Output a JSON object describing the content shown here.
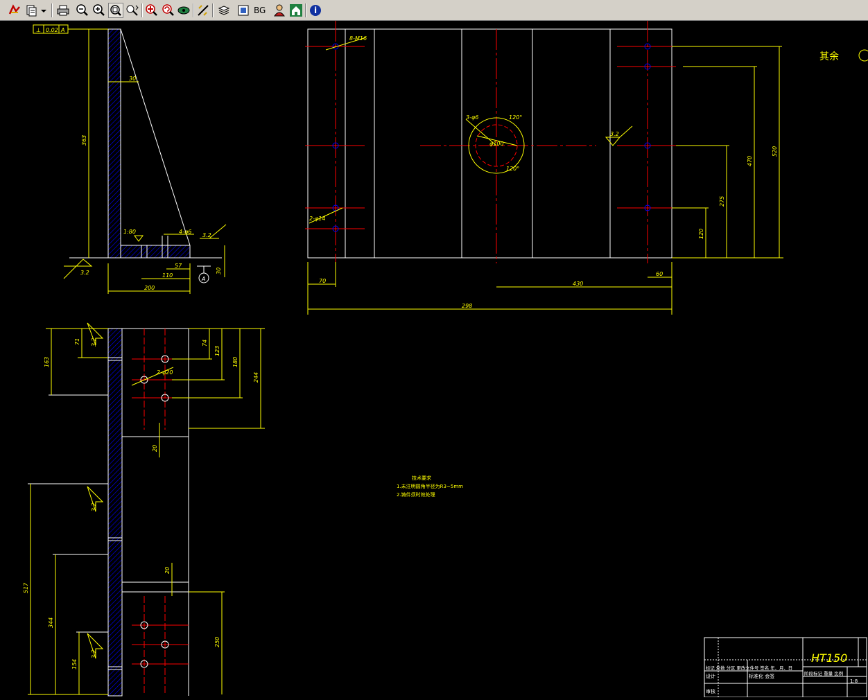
{
  "toolbar": {
    "buttons": [
      {
        "name": "open-icon"
      },
      {
        "name": "pages-icon"
      },
      {
        "name": "dropdown-arrow-icon"
      },
      {
        "name": "print-icon"
      },
      {
        "name": "zoom-out-icon"
      },
      {
        "name": "zoom-in-icon"
      },
      {
        "name": "zoom-window-icon"
      },
      {
        "name": "pan-icon"
      },
      {
        "name": "zoom-extents-icon"
      },
      {
        "name": "zoom-realtime-icon"
      },
      {
        "name": "view-3d-icon"
      },
      {
        "name": "measure-icon"
      },
      {
        "name": "layers-icon"
      },
      {
        "name": "frame-icon"
      },
      {
        "name": "home-icon"
      },
      {
        "name": "info-icon"
      }
    ],
    "bg_label": "BG"
  },
  "drawing": {
    "top_left": {
      "tolerance_box": [
        "⊥",
        "0.02",
        "A"
      ],
      "dims": {
        "d30": "30",
        "d363": "363",
        "d180": "1:80",
        "d4": "4-φ6",
        "d32a": "3.2",
        "d32b": "3.2",
        "d57": "57",
        "d110": "110",
        "d200": "200",
        "d30b": "30",
        "datum": "A"
      }
    },
    "top_right": {
      "dims": {
        "m16": "8-M16",
        "d14": "2-φ14",
        "d6": "3-φ6",
        "d100": "φ100",
        "a120a": "120°",
        "a120b": "120°",
        "ra": "3.2",
        "d70": "70",
        "d430": "430",
        "d60": "60",
        "d298": "298",
        "d120": "120",
        "d275": "275",
        "d470": "470",
        "d520": "520"
      },
      "remainder": "其余"
    },
    "bottom_left": {
      "dims": {
        "d71": "71",
        "d32a": "3.2",
        "d163": "163",
        "d74": "74",
        "d123": "123",
        "d180": "180",
        "d244": "244",
        "d20hole": "2-φ20",
        "d20a": "20",
        "d32b": "3.2",
        "d517": "517",
        "d20b": "20",
        "d344": "344",
        "d32c": "3.2",
        "d154": "154",
        "d250": "250"
      }
    },
    "tech_notes": {
      "title": "技术要求",
      "line1": "1.未注明圆角半径为R3~5mm",
      "line2": "2.铸件须时效处理"
    },
    "title_block": {
      "material": "HT150",
      "row1": "标记 处数 分区 更改文件号 签名 年、月、日",
      "row2a": "设计",
      "row2b": "标准化 会签",
      "row2c": "阶段标记 重量 比例",
      "row3a": "审核",
      "scale": "1:8"
    }
  },
  "colors": {
    "dim": "#ffff00",
    "outline": "#ffffff",
    "center": "#ff0000",
    "hatch": "#0000ff",
    "hole": "#0000ff",
    "toolbar": "#d4d0c8"
  }
}
